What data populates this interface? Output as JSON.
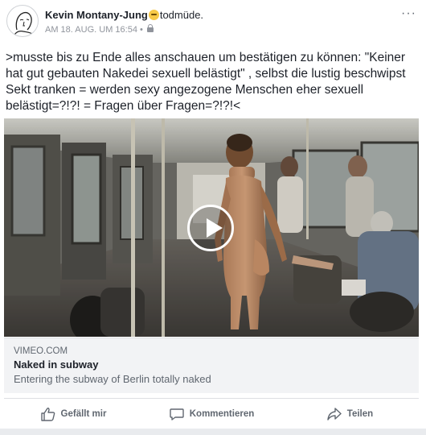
{
  "post": {
    "author": "Kevin Montany-Jung",
    "mood": "todmüde.",
    "timestamp": "AM 18. AUG. UM 16:54",
    "separator": "•",
    "more_label": "···",
    "text": ">musste bis zu Ende alles anschauen um bestätigen zu können: \"Keiner hat  gut gebauten Nakedei sexuell belästigt\" , selbst die lustig beschwipst Sekt tranken =  werden sexy  angezogene Menschen eher sexuell belästigt=?!?! = Fragen über Fragen=?!?!<"
  },
  "link_preview": {
    "domain": "VIMEO.COM",
    "title": "Naked in subway",
    "description": "Entering the subway of Berlin totally naked"
  },
  "actions": {
    "like": "Gefällt mir",
    "comment": "Kommentieren",
    "share": "Teilen"
  },
  "colors": {
    "text": "#1d2129",
    "secondary": "#606770",
    "meta": "#90949c",
    "preview_bg": "#f2f3f5"
  }
}
